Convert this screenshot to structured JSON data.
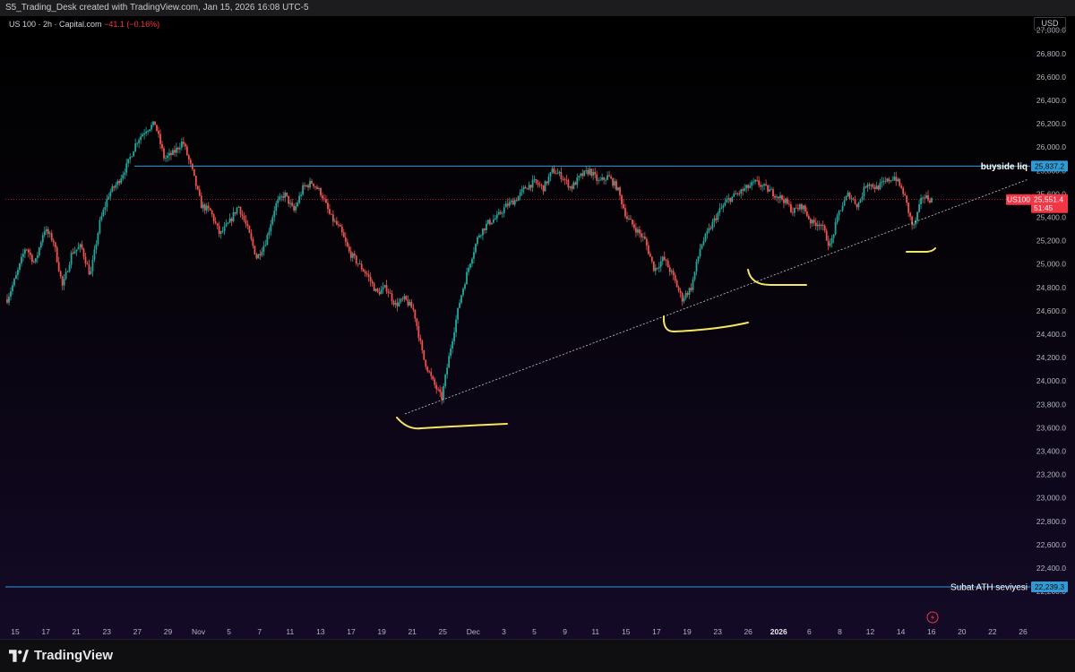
{
  "header": {
    "title": "S5_Trading_Desk created with TradingView.com, Jan 15, 2026 16:08 UTC-5"
  },
  "legend": {
    "symbol": "US 100 · 2h · Capital.com",
    "change": "−41.1 (−0.16%)"
  },
  "currency": "USD",
  "brand": "TradingView",
  "colors": {
    "up": "#26a69a",
    "down": "#ef5350",
    "hline": "#2f9bd6",
    "marker": "#f5e663",
    "price_label": "#f23645"
  },
  "chart_data": {
    "type": "line",
    "title": "",
    "xlabel": "",
    "ylabel": "",
    "ylim": [
      21940,
      27120
    ],
    "x_ticks": [
      "15",
      "17",
      "21",
      "23",
      "27",
      "29",
      "Nov",
      "5",
      "7",
      "11",
      "13",
      "17",
      "19",
      "21",
      "25",
      "Dec",
      "3",
      "5",
      "9",
      "11",
      "15",
      "17",
      "19",
      "23",
      "26",
      "2026",
      "6",
      "8",
      "12",
      "14",
      "16",
      "20",
      "22",
      "26"
    ],
    "y_ticks": [
      "27,000.0",
      "26,800.0",
      "26,600.0",
      "26,400.0",
      "26,200.0",
      "26,000.0",
      "25,800.0",
      "25,600.0",
      "25,400.0",
      "25,200.0",
      "25,000.0",
      "24,800.0",
      "24,600.0",
      "24,400.0",
      "24,200.0",
      "24,000.0",
      "23,800.0",
      "23,600.0",
      "23,400.0",
      "23,200.0",
      "23,000.0",
      "22,800.0",
      "22,600.0",
      "22,400.0",
      "22,200.0"
    ],
    "series": [
      {
        "values": [
          24700,
          24900,
          25150,
          25000,
          25300,
          25200,
          24800,
          25100,
          25150,
          24900,
          25350,
          25600,
          25700,
          25850,
          26050,
          26150,
          26200,
          25900,
          25950,
          26050,
          25800,
          25500,
          25450,
          25250,
          25350,
          25500,
          25300,
          25050,
          25200,
          25500,
          25600,
          25450,
          25650,
          25700,
          25600,
          25400,
          25300,
          25100,
          25000,
          24900,
          24750,
          24800,
          24650,
          24700,
          24600,
          24200,
          24000,
          23850,
          24300,
          24700,
          25000,
          25250,
          25350,
          25400,
          25500,
          25550,
          25650,
          25700,
          25650,
          25800,
          25750,
          25650,
          25750,
          25800,
          25700,
          25750,
          25650,
          25400,
          25300,
          25200,
          24950,
          25050,
          24900,
          24700,
          24800,
          25150,
          25300,
          25450,
          25550,
          25600,
          25650,
          25700,
          25650,
          25600,
          25550,
          25450,
          25500,
          25350,
          25350,
          25150,
          25450,
          25600,
          25500,
          25700,
          25650,
          25700,
          25750,
          25600,
          25300,
          25580,
          25550
        ]
      }
    ],
    "levels": [
      {
        "label": "buyside liq",
        "value": 25837.2,
        "value_text": "25,837.2"
      },
      {
        "label": "Subat ATH seviyesi",
        "value": 22239.3,
        "value_text": "22,239.3"
      }
    ],
    "current_price": {
      "label": "US100",
      "value": 25551.4,
      "value_text": "25,551.4",
      "countdown": "51:45"
    }
  }
}
